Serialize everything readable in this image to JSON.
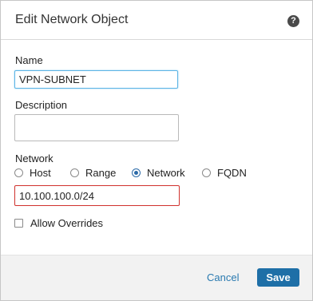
{
  "dialog": {
    "title": "Edit Network Object",
    "help_icon": "question-circle-icon",
    "help_glyph": "?"
  },
  "form": {
    "name_label": "Name",
    "name_value": "VPN-SUBNET",
    "description_label": "Description",
    "description_value": "",
    "network_label": "Network",
    "network_types": [
      {
        "label": "Host",
        "selected": false
      },
      {
        "label": "Range",
        "selected": false
      },
      {
        "label": "Network",
        "selected": true
      },
      {
        "label": "FQDN",
        "selected": false
      }
    ],
    "network_value": "10.100.100.0/24",
    "allow_overrides_label": "Allow Overrides",
    "allow_overrides_checked": false
  },
  "footer": {
    "cancel_label": "Cancel",
    "save_label": "Save"
  },
  "colors": {
    "primary": "#1e6fa7",
    "link": "#2a7ab0",
    "focus_border": "#5bb4e5",
    "error_border": "#d0312d"
  }
}
